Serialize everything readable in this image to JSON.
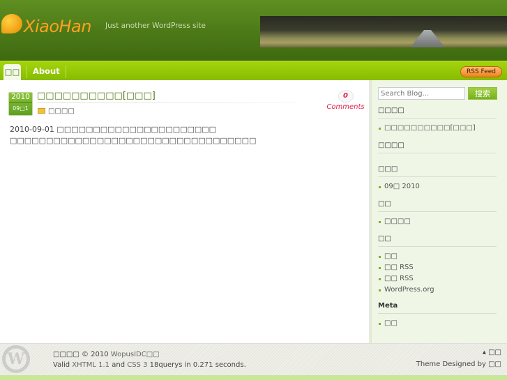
{
  "header": {
    "site_name": "XiaoHan",
    "tagline": "Just another WordPress site"
  },
  "nav": {
    "items": [
      {
        "label": "□□"
      },
      {
        "label": "About"
      }
    ],
    "rss_label": "RSS Feed"
  },
  "post": {
    "year": "2010",
    "month_day": "09□1",
    "title": "□□□□□□□□□□[□□□]",
    "category": "□□□□",
    "comment_count": "0",
    "comments_label": "Comments",
    "excerpt_line1": "2010-09-01 □□□□□□□□□□□□□□□□□□□□□□",
    "excerpt_line2": "□□□□□□□□□□□□□□□□□□□□□□□□□□□□□□□□□□"
  },
  "sidebar": {
    "search_placeholder": "Search Blog...",
    "search_button": "搜索",
    "widgets": [
      {
        "title": "□□□□",
        "items": [
          "□□□□□□□□□□[□□□]"
        ]
      },
      {
        "title": "□□□□",
        "items": []
      },
      {
        "title": "□□□",
        "items": [
          "09□ 2010"
        ]
      },
      {
        "title": "□□",
        "items": [
          "□□□□"
        ]
      },
      {
        "title": "□□",
        "items": [
          "□□",
          "□□ RSS",
          "□□ RSS",
          "WordPress.org"
        ]
      },
      {
        "title": "Meta",
        "items": [
          "□□"
        ]
      }
    ]
  },
  "footer": {
    "copyright_prefix": "□□□□ © 2010 ",
    "copyright_link": "WopusIDC□□",
    "valid": "Valid ",
    "xhtml": "XHTML 1.1",
    "and": " and ",
    "css": "CSS 3",
    "stats": " 18querys in 0.271 seconds.",
    "to_top": "▴ □□",
    "designed_by": "Theme Designed by □□"
  }
}
